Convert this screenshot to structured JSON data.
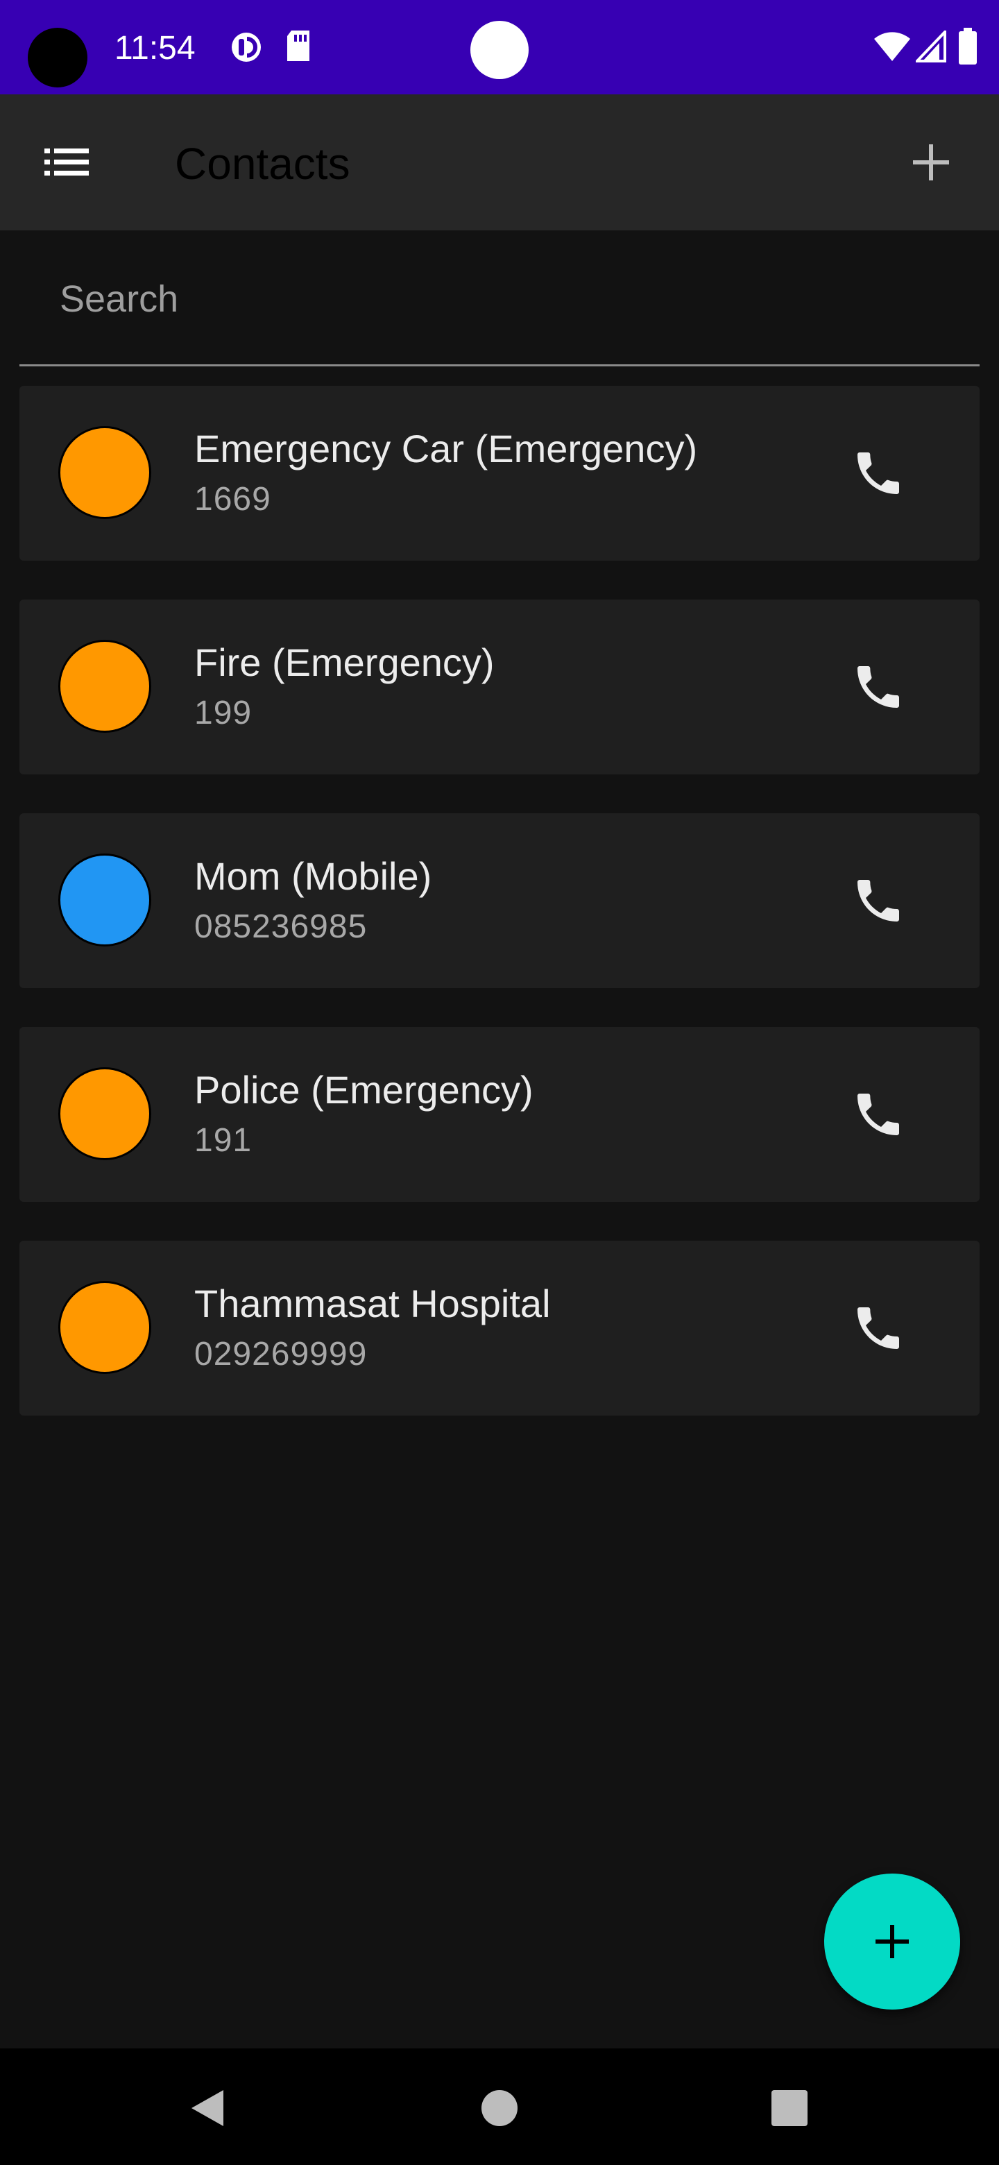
{
  "status_bar": {
    "time": "11:54",
    "icons": [
      "camera-dot",
      "data-saver-icon",
      "sd-card-icon",
      "wifi-icon",
      "signal-icon",
      "battery-icon"
    ]
  },
  "toolbar": {
    "title": "Contacts",
    "menu_icon": "list-menu-icon",
    "add_icon": "plus-icon"
  },
  "search": {
    "placeholder": "Search",
    "value": ""
  },
  "contacts": [
    {
      "name": "Emergency Car (Emergency)",
      "number": "1669",
      "avatar_color": "#FF9800"
    },
    {
      "name": "Fire (Emergency)",
      "number": "199",
      "avatar_color": "#FF9800"
    },
    {
      "name": "Mom (Mobile)",
      "number": "085236985",
      "avatar_color": "#2196F3"
    },
    {
      "name": "Police (Emergency)",
      "number": "191",
      "avatar_color": "#FF9800"
    },
    {
      "name": "Thammasat Hospital",
      "number": "029269999",
      "avatar_color": "#FF9800"
    }
  ],
  "fab": {
    "icon": "plus-icon",
    "color": "#03DAC5"
  },
  "nav_bar": {
    "icons": [
      "back-icon",
      "home-icon",
      "recents-icon"
    ]
  },
  "colors": {
    "status_bar": "#3700B3",
    "toolbar": "#272727",
    "background": "#121212",
    "card": "#1F1F1F"
  }
}
